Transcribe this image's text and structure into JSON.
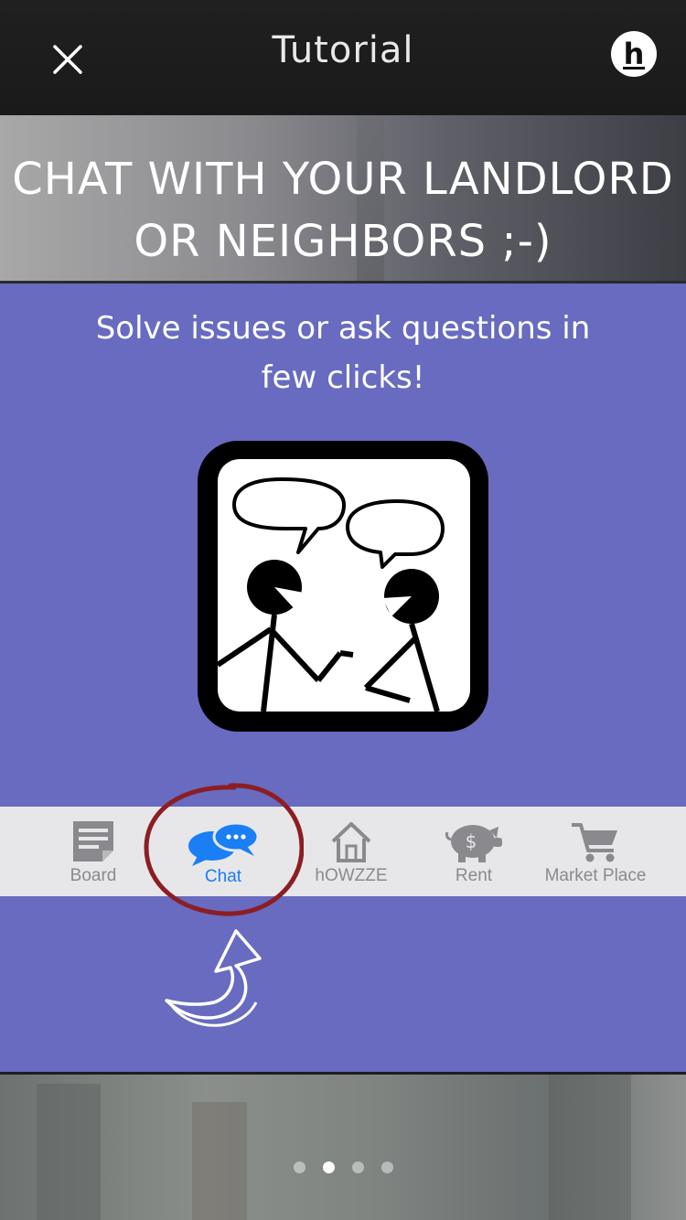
{
  "nav": {
    "title": "Tutorial",
    "close_icon": "close-icon",
    "logo_letter": "h"
  },
  "banner": {
    "line1": "CHAT WITH YOUR LANDLORD",
    "line2": "OR NEIGHBORS ;-)"
  },
  "content": {
    "subtitle_line1": "Solve issues or ask questions in",
    "subtitle_line2": "few clicks!",
    "illustration_icon": "people-chatting-icon"
  },
  "tabbar": {
    "tabs": [
      {
        "label": "Board",
        "icon": "board-icon",
        "active": false
      },
      {
        "label": "Chat",
        "icon": "chat-bubbles-icon",
        "active": true
      },
      {
        "label": "hOWZZE",
        "icon": "home-icon",
        "active": false
      },
      {
        "label": "Rent",
        "icon": "piggy-bank-icon",
        "active": false
      },
      {
        "label": "Market Place",
        "icon": "shopping-cart-icon",
        "active": false
      }
    ],
    "inactive_color": "#8a8a8e",
    "active_color": "#1a7ef5",
    "highlight_color": "#8b1e24"
  },
  "pager": {
    "total": 4,
    "current": 2
  },
  "colors": {
    "panel": "#686bbf",
    "navbar": "#1c1c1c"
  }
}
